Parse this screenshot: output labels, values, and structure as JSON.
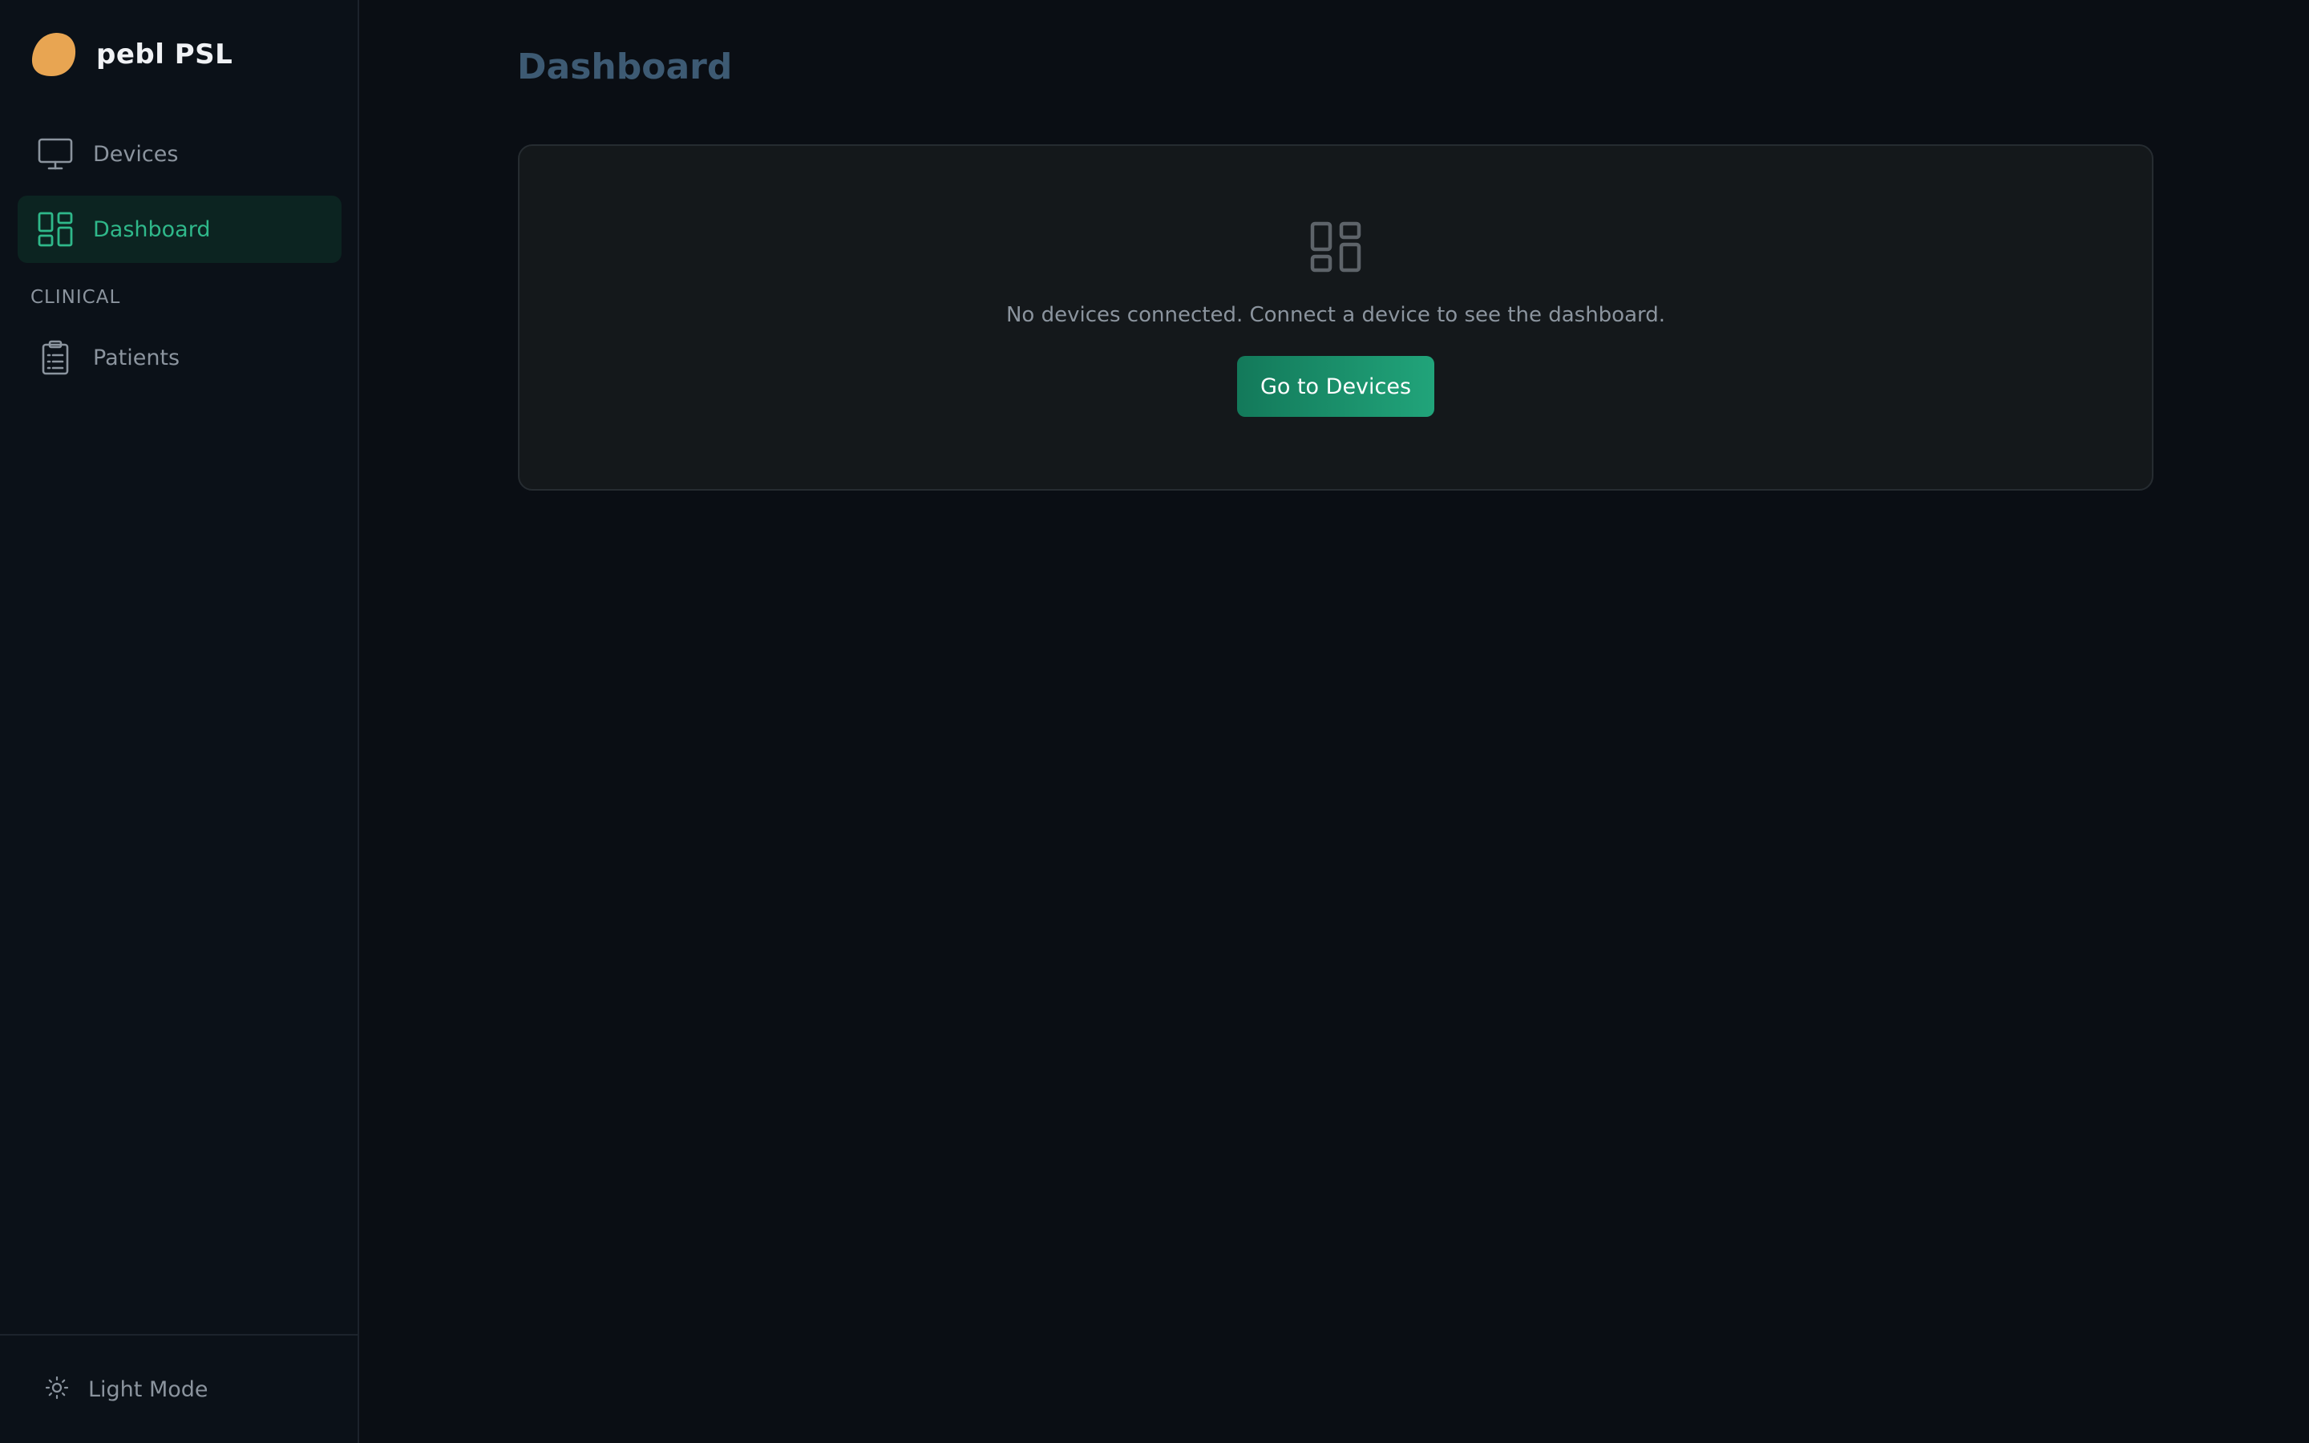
{
  "app": {
    "name": "pebl PSL",
    "logo_color": "#e8a552"
  },
  "sidebar": {
    "items": [
      {
        "label": "Devices",
        "icon": "monitor-icon",
        "active": false
      },
      {
        "label": "Dashboard",
        "icon": "dashboard-grid-icon",
        "active": true
      }
    ],
    "section_clinical": "CLINICAL",
    "clinical_items": [
      {
        "label": "Patients",
        "icon": "clipboard-icon",
        "active": false
      }
    ],
    "footer": {
      "theme_toggle_label": "Light Mode",
      "theme_toggle_icon": "sun-icon"
    }
  },
  "main": {
    "title": "Dashboard",
    "empty_state": {
      "icon": "dashboard-grid-icon",
      "message": "No devices connected. Connect a device to see the dashboard.",
      "button_label": "Go to Devices"
    }
  },
  "colors": {
    "accent": "#2fb88a",
    "button_gradient_start": "#13795a",
    "button_gradient_end": "#21a47a",
    "background": "#0a0e14",
    "title": "#3d5a73"
  }
}
